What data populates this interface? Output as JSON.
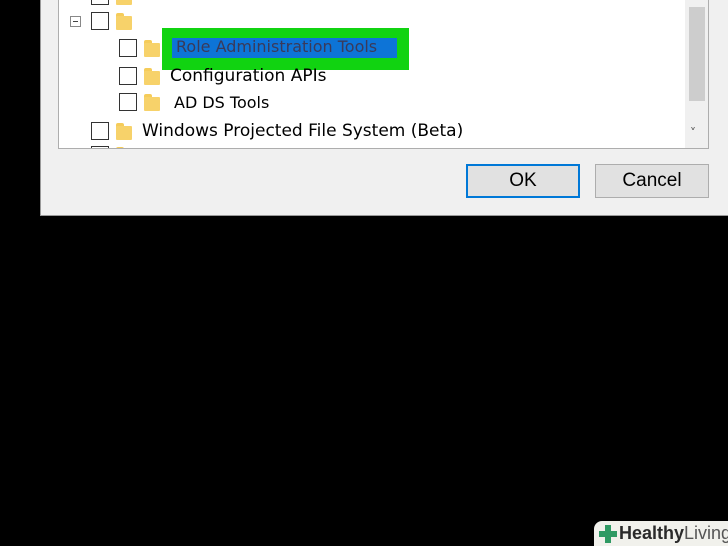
{
  "tree": {
    "items": [
      {
        "label": ""
      },
      {
        "label": ""
      },
      {
        "label": "Role Administration Tools"
      },
      {
        "label": "Configuration APIs"
      },
      {
        "label": "AD DS Tools"
      },
      {
        "label": "Windows Projected File System (Beta)"
      }
    ]
  },
  "buttons": {
    "ok": "OK",
    "cancel": "Cancel"
  },
  "scrollbar": {
    "down_arrow": "˅"
  },
  "watermark": {
    "part1": "Healthy",
    "part2": "Living"
  },
  "colors": {
    "highlight": "#11d311",
    "selection": "#0d74d7",
    "ok_border": "#0078d7",
    "logo_green": "#2f9a64"
  }
}
